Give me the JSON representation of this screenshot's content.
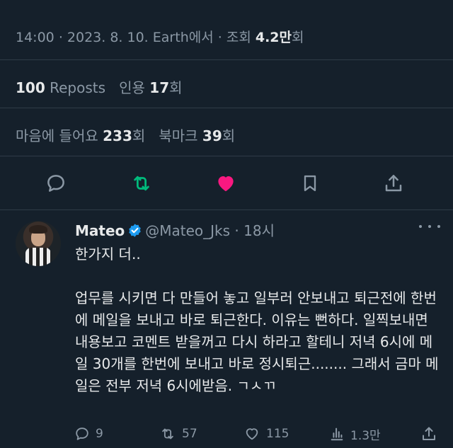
{
  "meta": {
    "time": "14:00",
    "date": "2023. 8. 10.",
    "source": "Earth에서",
    "views_label": "조회",
    "views_value": "4.2만",
    "views_suffix": "회"
  },
  "stats_row1": {
    "reposts_value": "100",
    "reposts_label": "Reposts",
    "quotes_label": "인용",
    "quotes_value": "17",
    "quotes_suffix": "회"
  },
  "stats_row2": {
    "likes_label": "마음에 들어요",
    "likes_value": "233",
    "likes_suffix": "회",
    "bookmarks_label": "북마크",
    "bookmarks_value": "39",
    "bookmarks_suffix": "회"
  },
  "actions": {
    "reply_icon": "reply-icon",
    "repost_icon": "repost-icon",
    "like_icon": "heart-icon",
    "bookmark_icon": "bookmark-icon",
    "share_icon": "share-icon",
    "repost_color": "#00ba7c",
    "like_color": "#f91880"
  },
  "reply_tweet": {
    "name": "Mateo",
    "handle": "@Mateo_Jks",
    "age": "18시",
    "text": "한가지 더..\n\n업무를 시키면 다 만들어 놓고 일부러 안보내고 퇴근전에 한번에 메일을 보내고 바로 퇴근한다. 이유는 뻔하다. 일찍보내면 내용보고 코멘트 받을꺼고 다시 하라고 할테니 저녁 6시에 메일 30개를 한번에 보내고 바로 정시퇴근........ 그래서 금마 메일은 전부 저녁 6시에받음. ㄱㅅㄲ",
    "replies": "9",
    "reposts": "57",
    "likes": "115",
    "views": "1.3만"
  },
  "colors": {
    "background": "#15202b",
    "text": "#e7e9ea",
    "muted": "#8b98a5",
    "verified": "#1d9bf0"
  }
}
